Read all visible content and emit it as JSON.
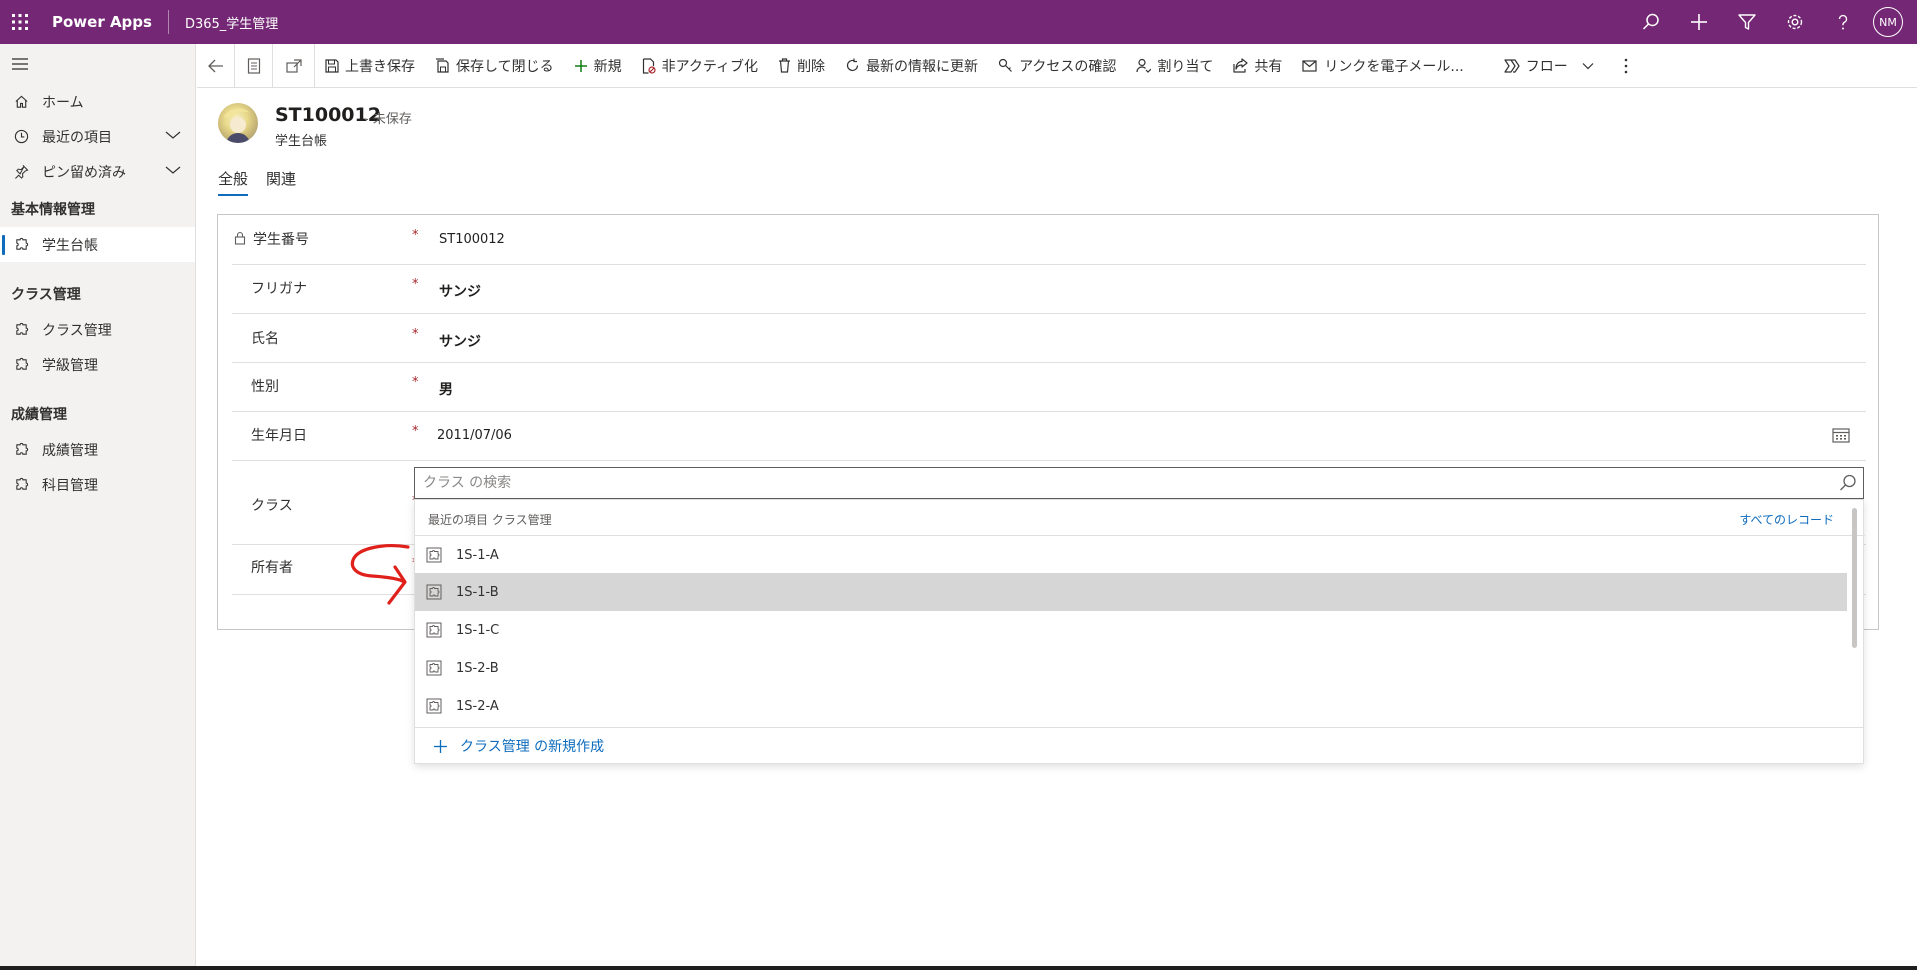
{
  "topbar": {
    "app_name": "Power Apps",
    "environment": "D365_学生管理",
    "user_initials": "NM",
    "icons": [
      "search-icon",
      "plus-icon",
      "filter-icon",
      "settings-icon",
      "help-icon"
    ]
  },
  "sidebar": {
    "items": [
      {
        "label": "ホーム",
        "icon": "home-icon"
      },
      {
        "label": "最近の項目",
        "icon": "clock-icon"
      },
      {
        "label": "ピン留め済み",
        "icon": "pin-icon"
      }
    ],
    "groups": [
      {
        "title": "基本情報管理",
        "items": [
          {
            "label": "学生台帳",
            "active": true
          }
        ]
      },
      {
        "title": "クラス管理",
        "items": [
          {
            "label": "クラス管理"
          },
          {
            "label": "学級管理"
          }
        ]
      },
      {
        "title": "成績管理",
        "items": [
          {
            "label": "成績管理"
          },
          {
            "label": "科目管理"
          }
        ]
      }
    ]
  },
  "commandbar": {
    "save": "上書き保存",
    "save_close": "保存して閉じる",
    "new": "新規",
    "deactivate": "非アクティブ化",
    "delete": "削除",
    "refresh": "最新の情報に更新",
    "check_access": "アクセスの確認",
    "assign": "割り当て",
    "share": "共有",
    "email_link": "リンクを電子メール...",
    "flow": "フロー"
  },
  "record": {
    "title": "ST100012",
    "status": "- 未保存",
    "entity": "学生台帳"
  },
  "tabs": [
    "全般",
    "関連"
  ],
  "form": {
    "student_no": {
      "label": "学生番号",
      "value": "ST100012"
    },
    "furigana": {
      "label": "フリガナ",
      "value": "サンジ"
    },
    "name": {
      "label": "氏名",
      "value": "サンジ"
    },
    "gender": {
      "label": "性別",
      "value": "男"
    },
    "birthdate": {
      "label": "生年月日",
      "value": "2011/07/06"
    },
    "class": {
      "label": "クラス"
    },
    "owner": {
      "label": "所有者"
    },
    "required_mark": "*"
  },
  "lookup": {
    "placeholder": "クラス の検索",
    "header_left": "最近の項目 クラス管理",
    "header_right": "すべてのレコード",
    "items": [
      "1S-1-A",
      "1S-1-B",
      "1S-1-C",
      "1S-2-B",
      "1S-2-A"
    ],
    "highlighted_index": 1,
    "new_label": "クラス管理 の新規作成"
  },
  "colors": {
    "brand": "#742774",
    "accent": "#0f6cbd",
    "required": "#a4262c",
    "annotation": "#e0201b"
  }
}
